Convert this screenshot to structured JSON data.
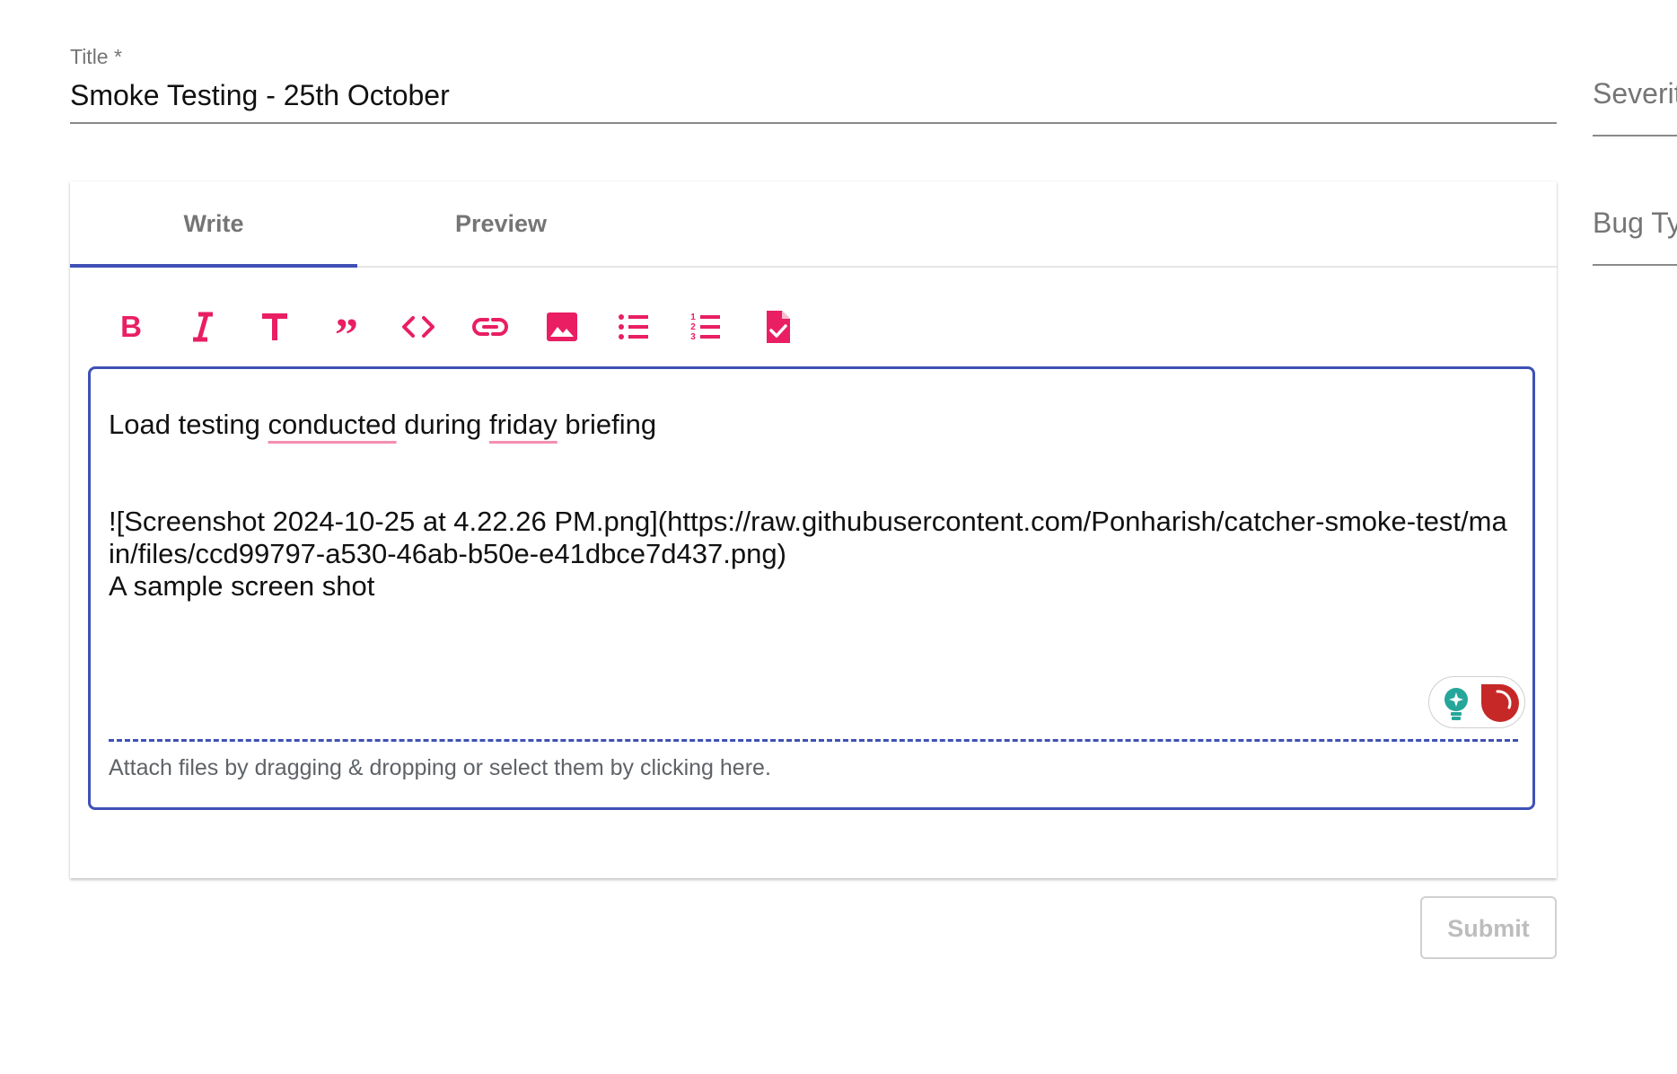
{
  "form": {
    "title_label": "Title *",
    "title_value": "Smoke Testing - 25th October",
    "severity_label": "Severity",
    "bug_type_label": "Bug Type"
  },
  "tabs": [
    {
      "label": "Write",
      "active": true
    },
    {
      "label": "Preview",
      "active": false
    }
  ],
  "toolbar": {
    "icons": [
      "bold-icon",
      "italic-icon",
      "heading-icon",
      "quote-icon",
      "code-icon",
      "link-icon",
      "image-icon",
      "bulleted-list-icon",
      "numbered-list-icon",
      "task-list-icon"
    ],
    "icon_color": "#e91e63"
  },
  "editor": {
    "line1_parts": [
      "Load testing ",
      "conducted",
      " during ",
      "friday",
      " briefing"
    ],
    "image_markdown": "![Screenshot 2024-10-25 at 4.22.26 PM.png](https://raw.githubusercontent.com/Ponharish/catcher-smoke-test/main/files/ccd99797-a530-46ab-b50e-e41dbce7d437.png)",
    "caption": "A sample screen shot",
    "attach_hint": "Attach files by dragging & dropping or select them by clicking here.",
    "accent_color": "#3f51b5"
  },
  "actions": {
    "submit_label": "Submit"
  }
}
